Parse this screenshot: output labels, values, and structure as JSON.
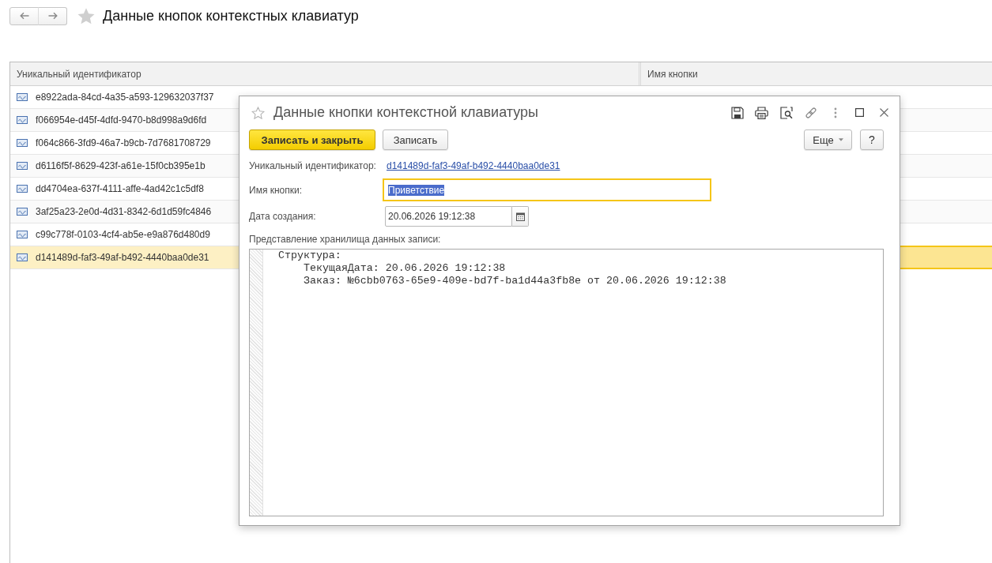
{
  "page": {
    "title": "Данные кнопок контекстных клавиатур"
  },
  "table": {
    "columns": [
      "Уникальный идентификатор",
      "Имя кнопки"
    ],
    "rows": [
      {
        "id": "e8922ada-84cd-4a35-a593-129632037f37",
        "selected": false
      },
      {
        "id": "f066954e-d45f-4dfd-9470-b8d998a9d6fd",
        "selected": false
      },
      {
        "id": "f064c866-3fd9-46a7-b9cb-7d7681708729",
        "selected": false
      },
      {
        "id": "d6116f5f-8629-423f-a61e-15f0cb395e1b",
        "selected": false
      },
      {
        "id": "dd4704ea-637f-4111-affe-4ad42c1c5df8",
        "selected": false
      },
      {
        "id": "3af25a23-2e0d-4d31-8342-6d1d59fc4846",
        "selected": false
      },
      {
        "id": "c99c778f-0103-4cf4-ab5e-e9a876d480d9",
        "selected": false
      },
      {
        "id": "d141489d-faf3-49af-b492-4440baa0de31",
        "selected": true
      }
    ]
  },
  "dialog": {
    "title": "Данные кнопки контекстной клавиатуры",
    "buttons": [
      {
        "label": "Записать и закрыть",
        "kind": "primary"
      },
      {
        "label": "Записать",
        "kind": "normal"
      }
    ],
    "more_button": "Еще",
    "help_button": "?",
    "fields": [
      {
        "kind": "link",
        "label": "Уникальный идентификатор:",
        "value": "d141489d-faf3-49af-b492-4440baa0de31",
        "focused": false
      },
      {
        "kind": "text",
        "label": "Имя кнопки:",
        "value": "Приветствие",
        "focused": true
      },
      {
        "kind": "date",
        "label": "Дата создания:",
        "value": "20.06.2026 19:12:38",
        "focused": false
      }
    ],
    "storage": {
      "label": "Представление хранилища данных записи:",
      "lines": [
        {
          "text": "Структура:",
          "children": [
            {
              "text": "ТекущаяДата: 20.06.2026 19:12:38"
            },
            {
              "text": "Заказ: №6cbb0763-65e9-409e-bd7f-ba1d44a3fb8e от 20.06.2026 19:12:38"
            }
          ]
        }
      ]
    }
  }
}
